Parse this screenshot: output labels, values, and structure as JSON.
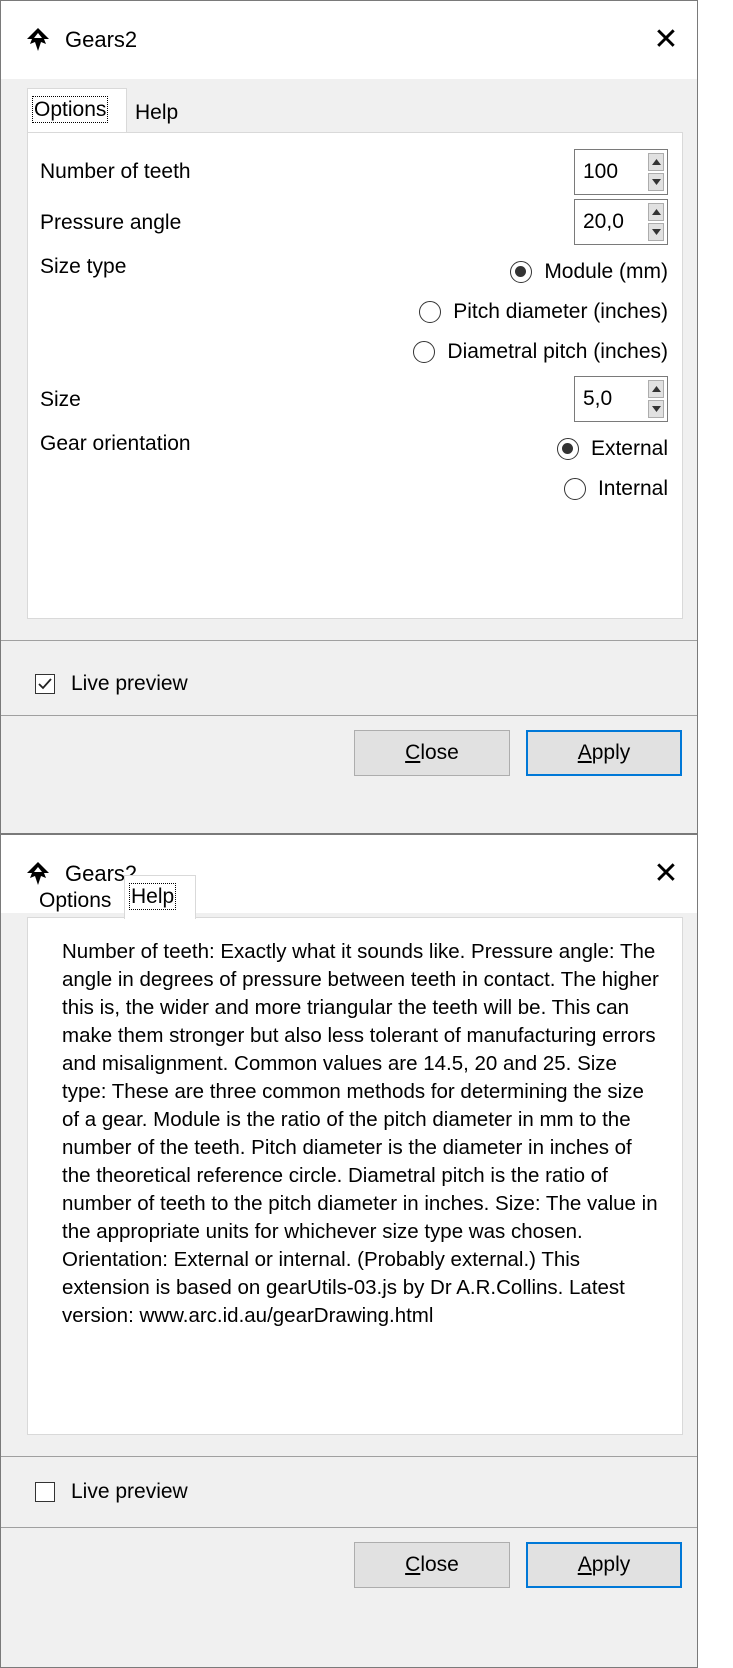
{
  "window_title": "Gears2",
  "close_glyph": "✕",
  "app_icon": "inkscape-icon",
  "tabs": {
    "options": "Options",
    "help": "Help"
  },
  "options": {
    "teeth_label": "Number of teeth",
    "teeth_value": "100",
    "pressure_label": "Pressure angle",
    "pressure_value": "20,0",
    "size_type_label": "Size type",
    "size_type_options": [
      "Module (mm)",
      "Pitch diameter (inches)",
      "Diametral pitch (inches)"
    ],
    "size_type_selected": "Module (mm)",
    "size_label": "Size",
    "size_value": "5,0",
    "orientation_label": "Gear orientation",
    "orientation_options": [
      "External",
      "Internal"
    ],
    "orientation_selected": "External"
  },
  "help_text": "Number of teeth: Exactly what it sounds like. Pressure angle: The angle in degrees of pressure between teeth in contact. The higher this is, the wider and more triangular the teeth will be. This can make them stronger but also less tolerant of manufacturing errors and misalignment. Common values are 14.5, 20 and 25. Size type: These are three common methods for determining the size of a gear. Module is the ratio of the pitch diameter in mm to the number of the teeth. Pitch diameter is the diameter in inches of the theoretical reference circle. Diametral pitch is the ratio of number of teeth to the pitch diameter in inches. Size: The value in the appropriate units for whichever size type was chosen. Orientation: External or internal. (Probably external.) This extension is based on gearUtils-03.js by Dr A.R.Collins. Latest version: www.arc.id.au/gearDrawing.html",
  "live_preview_label": "Live preview",
  "window1_live_preview_checked": true,
  "window2_live_preview_checked": false,
  "buttons": {
    "close_mnemonic": "C",
    "close_rest": "lose",
    "apply_mnemonic": "A",
    "apply_rest": "pply"
  },
  "colors": {
    "focus_border": "#0078d7",
    "dialog_bg": "#f0f0f0",
    "panel_bg": "#ffffff"
  }
}
